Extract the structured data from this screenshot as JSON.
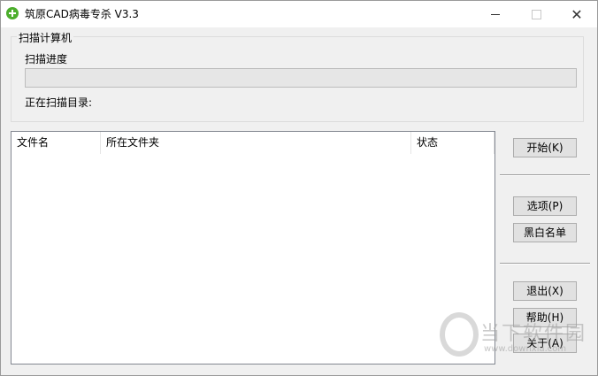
{
  "window": {
    "title": "筑原CAD病毒专杀  V3.3",
    "controls": {
      "minimize": "minimize",
      "maximize": "maximize",
      "close": "✕"
    }
  },
  "scan_group": {
    "title": "扫描计算机",
    "progress_label": "扫描进度",
    "progress_value": 0,
    "scan_dir_label": "正在扫描目录:"
  },
  "results_table": {
    "columns": [
      "文件名",
      "所在文件夹",
      "状态"
    ],
    "rows": []
  },
  "side_buttons": {
    "start": "开始(K)",
    "options": "选项(P)",
    "blackwhite_list": "黑白名单",
    "exit": "退出(X)",
    "help": "帮助(H)",
    "about": "关于(A)"
  },
  "watermark": {
    "text": "当下软件园",
    "url": "www.downxia.com"
  },
  "colors": {
    "app_icon": "#4cae2c",
    "progress_fill": "#06b025"
  },
  "icons": [
    "app-plus-icon",
    "minimize-icon",
    "maximize-icon",
    "close-icon"
  ]
}
